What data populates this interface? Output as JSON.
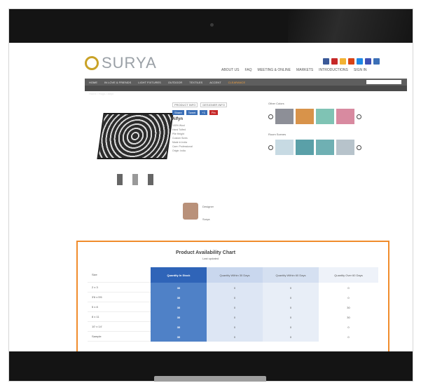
{
  "brand": {
    "logo_text": "SURYA"
  },
  "top_nav": [
    "ABOUT US",
    "FAQ",
    "MEETING & ONLINE",
    "MARKETS",
    "INTRODUCTIONS",
    "SIGN IN"
  ],
  "main_nav": [
    "HOME",
    "IN LOVE & FRIENDS",
    "LIGHT FIXTURES",
    "OUTDOOR",
    "TEXTILES",
    "ACCENT",
    "CLEARANCE"
  ],
  "breadcrumb": "Home / Rugs / Alfyn",
  "product": {
    "tabs": [
      "PRODUCT INFO",
      "DESIGNER INFO"
    ],
    "share": [
      "Share",
      "Tweet",
      "+1",
      "Pin"
    ],
    "name": "Alfyn",
    "features": [
      "100% Wool",
      "Hand Tufted",
      "Pile Height",
      "Custom Sizes",
      "Made in India",
      "Care: Professional",
      "Origin: India"
    ],
    "designer": [
      "Designer",
      "Surya"
    ]
  },
  "swatches": {
    "other_colors_label": "Other Colors",
    "room_scene_label": "Room Scenes"
  },
  "availability_chart": {
    "title": "Product Availability Chart",
    "subtitle": "Last updated",
    "headers": [
      "Size",
      "Quantity In Stock",
      "Quantity Within 30 Days",
      "Quantity Within 60 Days",
      "Quantity Over 60 Days"
    ],
    "rows": [
      {
        "size": "2 x 3",
        "in_stock": "30",
        "d30": "0",
        "d60": "0",
        "over": "0"
      },
      {
        "size": "3'6 x 5'6",
        "in_stock": "30",
        "d30": "0",
        "d60": "0",
        "over": "0"
      },
      {
        "size": "5 x 8",
        "in_stock": "30",
        "d30": "0",
        "d60": "0",
        "over": "30"
      },
      {
        "size": "8 x 11",
        "in_stock": "30",
        "d30": "0",
        "d60": "0",
        "over": "30"
      },
      {
        "size": "10' x 14'",
        "in_stock": "30",
        "d30": "0",
        "d60": "0",
        "over": "0"
      },
      {
        "size": "Sample",
        "in_stock": "30",
        "d30": "0",
        "d60": "0",
        "over": "0"
      }
    ]
  },
  "colors": {
    "accent_orange": "#f08c2c",
    "table_blue": "#4f81c7",
    "nav_gray": "#5e5e5e"
  }
}
